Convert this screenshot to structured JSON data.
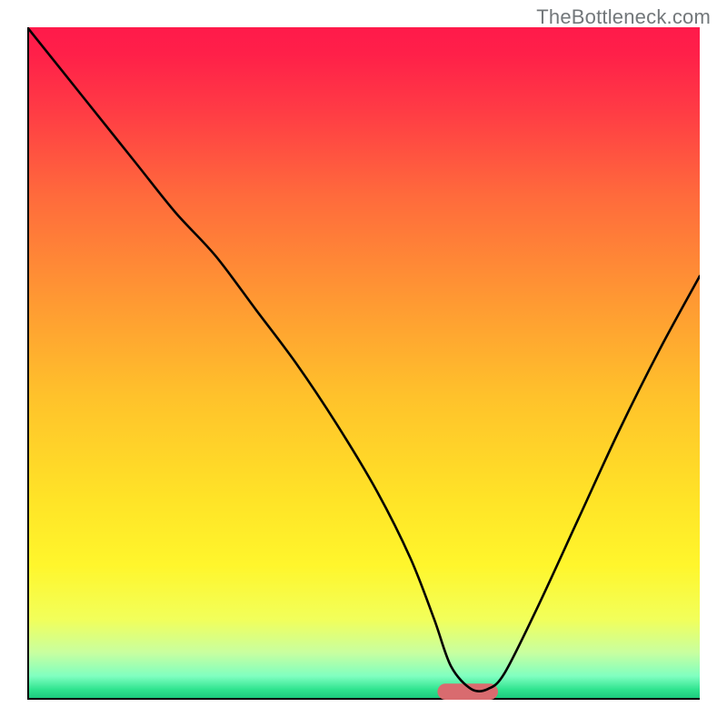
{
  "attribution": "TheBottleneck.com",
  "chart_data": {
    "type": "line",
    "title": "",
    "xlabel": "",
    "ylabel": "",
    "xlim": [
      0,
      100
    ],
    "ylim": [
      0,
      100
    ],
    "grid": false,
    "legend": "none",
    "axes": {
      "left": true,
      "bottom": true,
      "top": false,
      "right": false,
      "ticks": "none"
    },
    "background_gradient": {
      "stops": [
        {
          "offset": 0.0,
          "color": "#ff1a4a"
        },
        {
          "offset": 0.04,
          "color": "#ff2049"
        },
        {
          "offset": 0.12,
          "color": "#ff3a45"
        },
        {
          "offset": 0.25,
          "color": "#ff6a3c"
        },
        {
          "offset": 0.4,
          "color": "#ff9733"
        },
        {
          "offset": 0.55,
          "color": "#ffc22b"
        },
        {
          "offset": 0.7,
          "color": "#ffe327"
        },
        {
          "offset": 0.8,
          "color": "#fff62c"
        },
        {
          "offset": 0.88,
          "color": "#f2ff5a"
        },
        {
          "offset": 0.93,
          "color": "#c8ffa0"
        },
        {
          "offset": 0.965,
          "color": "#7fffc0"
        },
        {
          "offset": 0.985,
          "color": "#2fe38f"
        },
        {
          "offset": 1.0,
          "color": "#18c47a"
        }
      ]
    },
    "marker": {
      "shape": "rounded-bar",
      "x": 65.5,
      "y": 1.2,
      "width": 9,
      "height": 2.4,
      "color": "#d96b6f"
    },
    "series": [
      {
        "name": "bottleneck-curve",
        "color": "#000000",
        "width": 2.6,
        "x": [
          0,
          8,
          16,
          22,
          28,
          34,
          40,
          46,
          52,
          57,
          60.5,
          63,
          66,
          68.5,
          71,
          76,
          82,
          88,
          94,
          100
        ],
        "values": [
          100,
          90,
          80,
          72.5,
          66,
          58,
          50,
          41,
          31,
          21,
          12,
          5,
          1.6,
          1.6,
          4,
          14,
          27,
          40,
          52,
          63
        ]
      }
    ]
  }
}
